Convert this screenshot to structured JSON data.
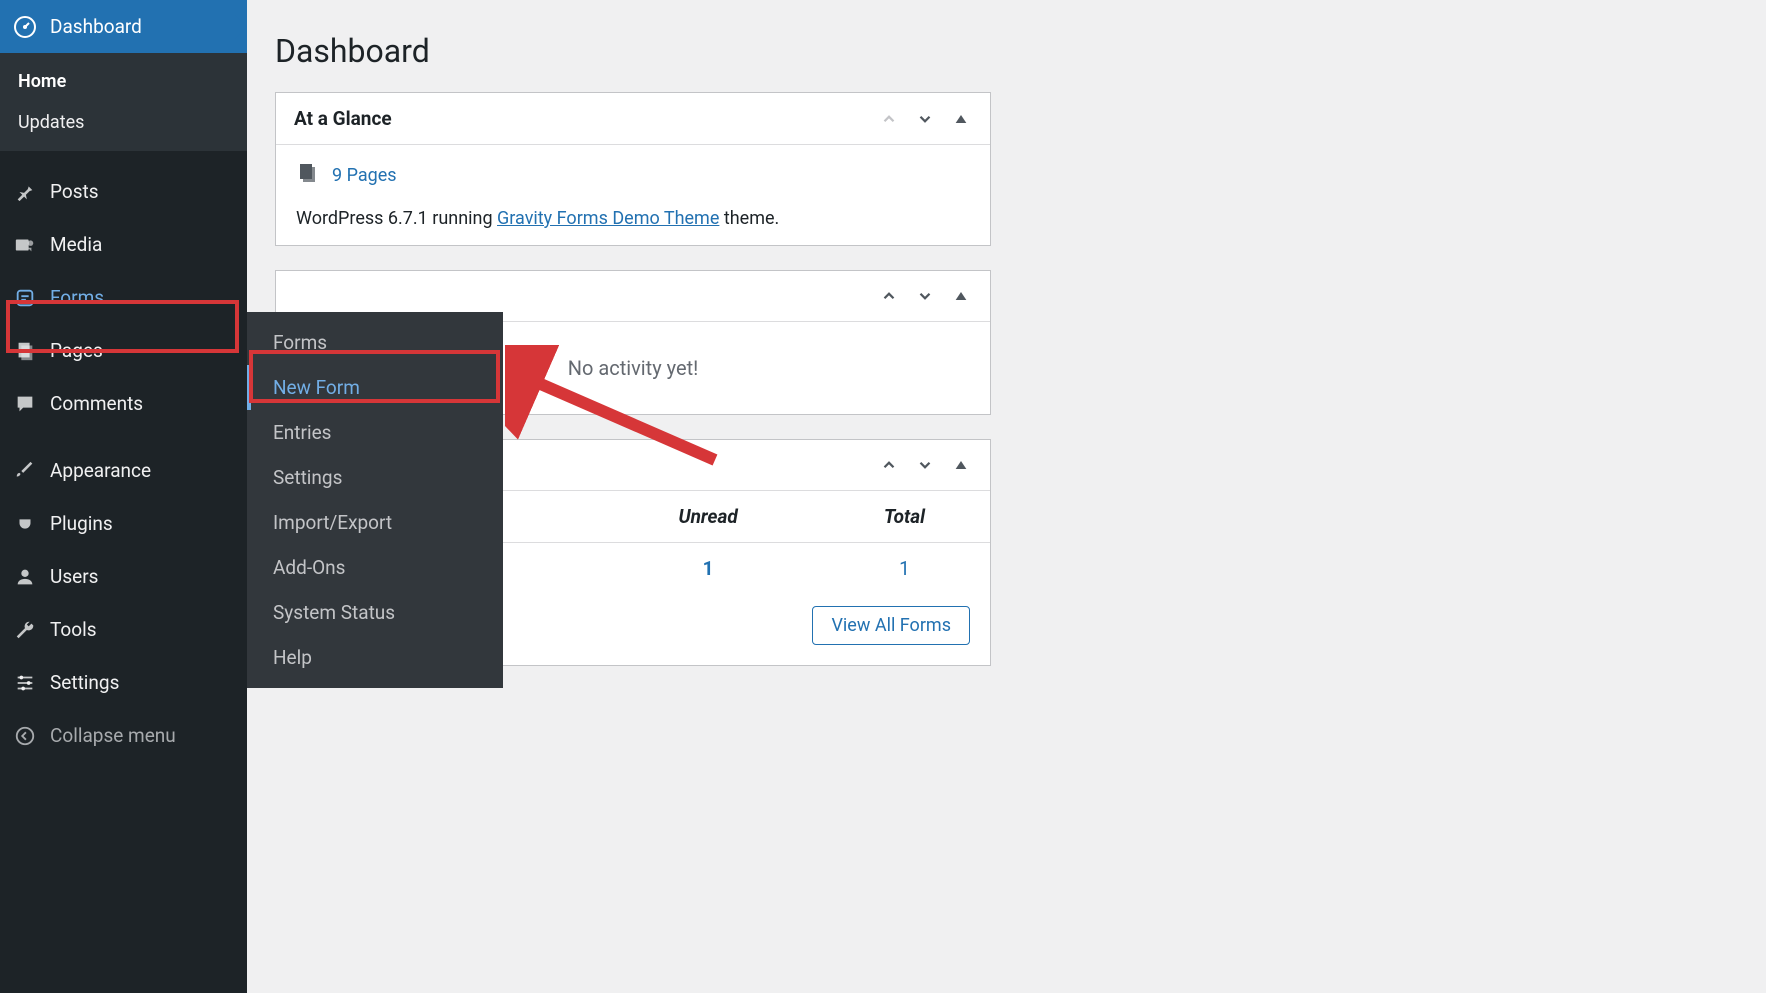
{
  "page_title": "Dashboard",
  "sidebar": {
    "dashboard": {
      "label": "Dashboard",
      "sub_home": "Home",
      "sub_updates": "Updates"
    },
    "posts": "Posts",
    "media": "Media",
    "forms": "Forms",
    "pages": "Pages",
    "comments": "Comments",
    "appearance": "Appearance",
    "plugins": "Plugins",
    "users": "Users",
    "tools": "Tools",
    "settings": "Settings",
    "collapse": "Collapse menu"
  },
  "forms_submenu": {
    "forms": "Forms",
    "new_form": "New Form",
    "entries": "Entries",
    "settings": "Settings",
    "import_export": "Import/Export",
    "addons": "Add-Ons",
    "system_status": "System Status",
    "help": "Help"
  },
  "at_a_glance": {
    "title": "At a Glance",
    "pages_link": "9 Pages",
    "wp_prefix": "WordPress 6.7.1 running ",
    "theme_link": "Gravity Forms Demo Theme",
    "wp_suffix": " theme."
  },
  "activity": {
    "no_activity": "No activity yet!"
  },
  "forms_panel": {
    "col_unread": "Unread",
    "col_total": "Total",
    "row_unread": "1",
    "row_total": "1",
    "view_all": "View All Forms"
  }
}
